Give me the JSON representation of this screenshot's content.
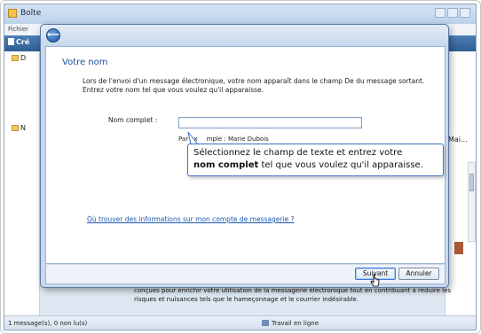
{
  "background_app": {
    "title": "Boîte",
    "menu": "Fichier",
    "toolbar_create": "Cré",
    "tree_item_1": "D",
    "tree_item_2": "N",
    "right_pane_header": "Mai...",
    "preview_text": "conçues pour enrichir votre utilisation de la messagerie électronique tout en contribuant à réduire les risques et nuisances tels que le hameçonnage et le courrier indésirable.",
    "status_left": "1 message(s), 0 non lu(s)",
    "status_right": "Travail en ligne"
  },
  "wizard": {
    "heading": "Votre nom",
    "intro": "Lors de l'envoi d'un message électronique, votre nom apparaît dans le champ De du message sortant. Entrez votre nom tel que vous voulez qu'il apparaisse.",
    "field_label": "Nom complet :",
    "field_value": "",
    "example_prefix": "Par ex",
    "example_suffix": "mple : Marie Dubois",
    "help_link": "Où trouver des informations sur mon compte de messagerie ?",
    "next_button": "Suivant",
    "cancel_button": "Annuler"
  },
  "callout": {
    "line1": "Sélectionnez le champ de texte et entrez votre",
    "bold": "nom complet",
    "line2_rest": " tel que vous voulez qu'il apparaisse."
  },
  "colors": {
    "heading": "#1e4f99",
    "link": "#1a58b0",
    "callout_border": "#3f72c2"
  },
  "icons": [
    "back-arrow-icon",
    "folder-icon",
    "mouse-cursor-icon",
    "app-icon"
  ]
}
